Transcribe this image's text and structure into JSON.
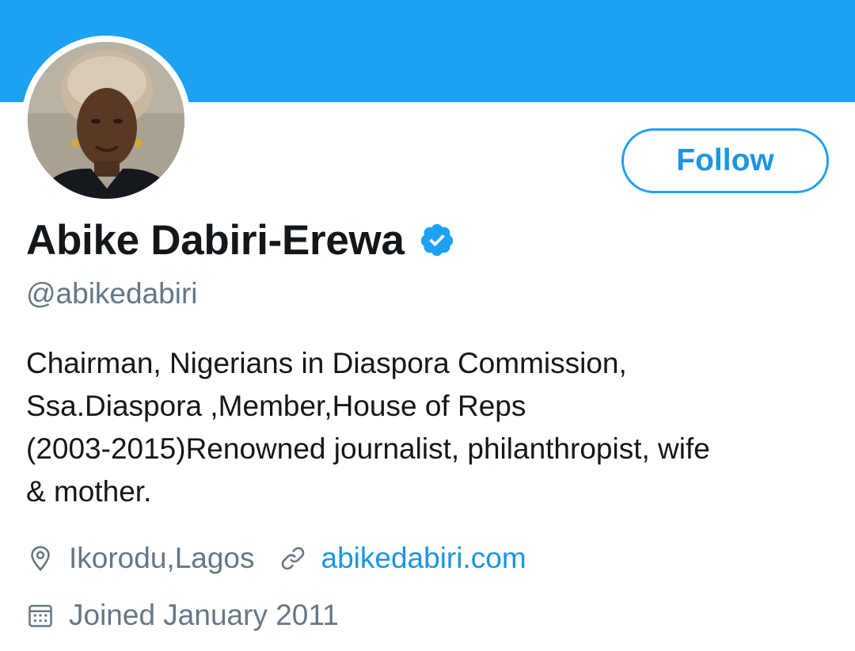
{
  "profile": {
    "display_name": "Abike Dabiri-Erewa",
    "verified": true,
    "handle": "@abikedabiri",
    "follow_label": "Follow",
    "bio_lines": [
      "Chairman, Nigerians in Diaspora Commission,",
      "Ssa.Diaspora ,Member,House of Reps",
      "(2003-2015)Renowned journalist, philanthropist, wife",
      "& mother."
    ],
    "location": "Ikorodu,Lagos",
    "website": "abikedabiri.com",
    "joined": "Joined January 2011"
  },
  "icons": {
    "location": "location-pin-icon",
    "link": "link-icon",
    "calendar": "calendar-icon",
    "verified": "verified-badge-icon"
  },
  "colors": {
    "banner": "#1da1f2",
    "accent": "#1b95e0",
    "text_primary": "#14171a",
    "text_secondary": "#657786"
  }
}
